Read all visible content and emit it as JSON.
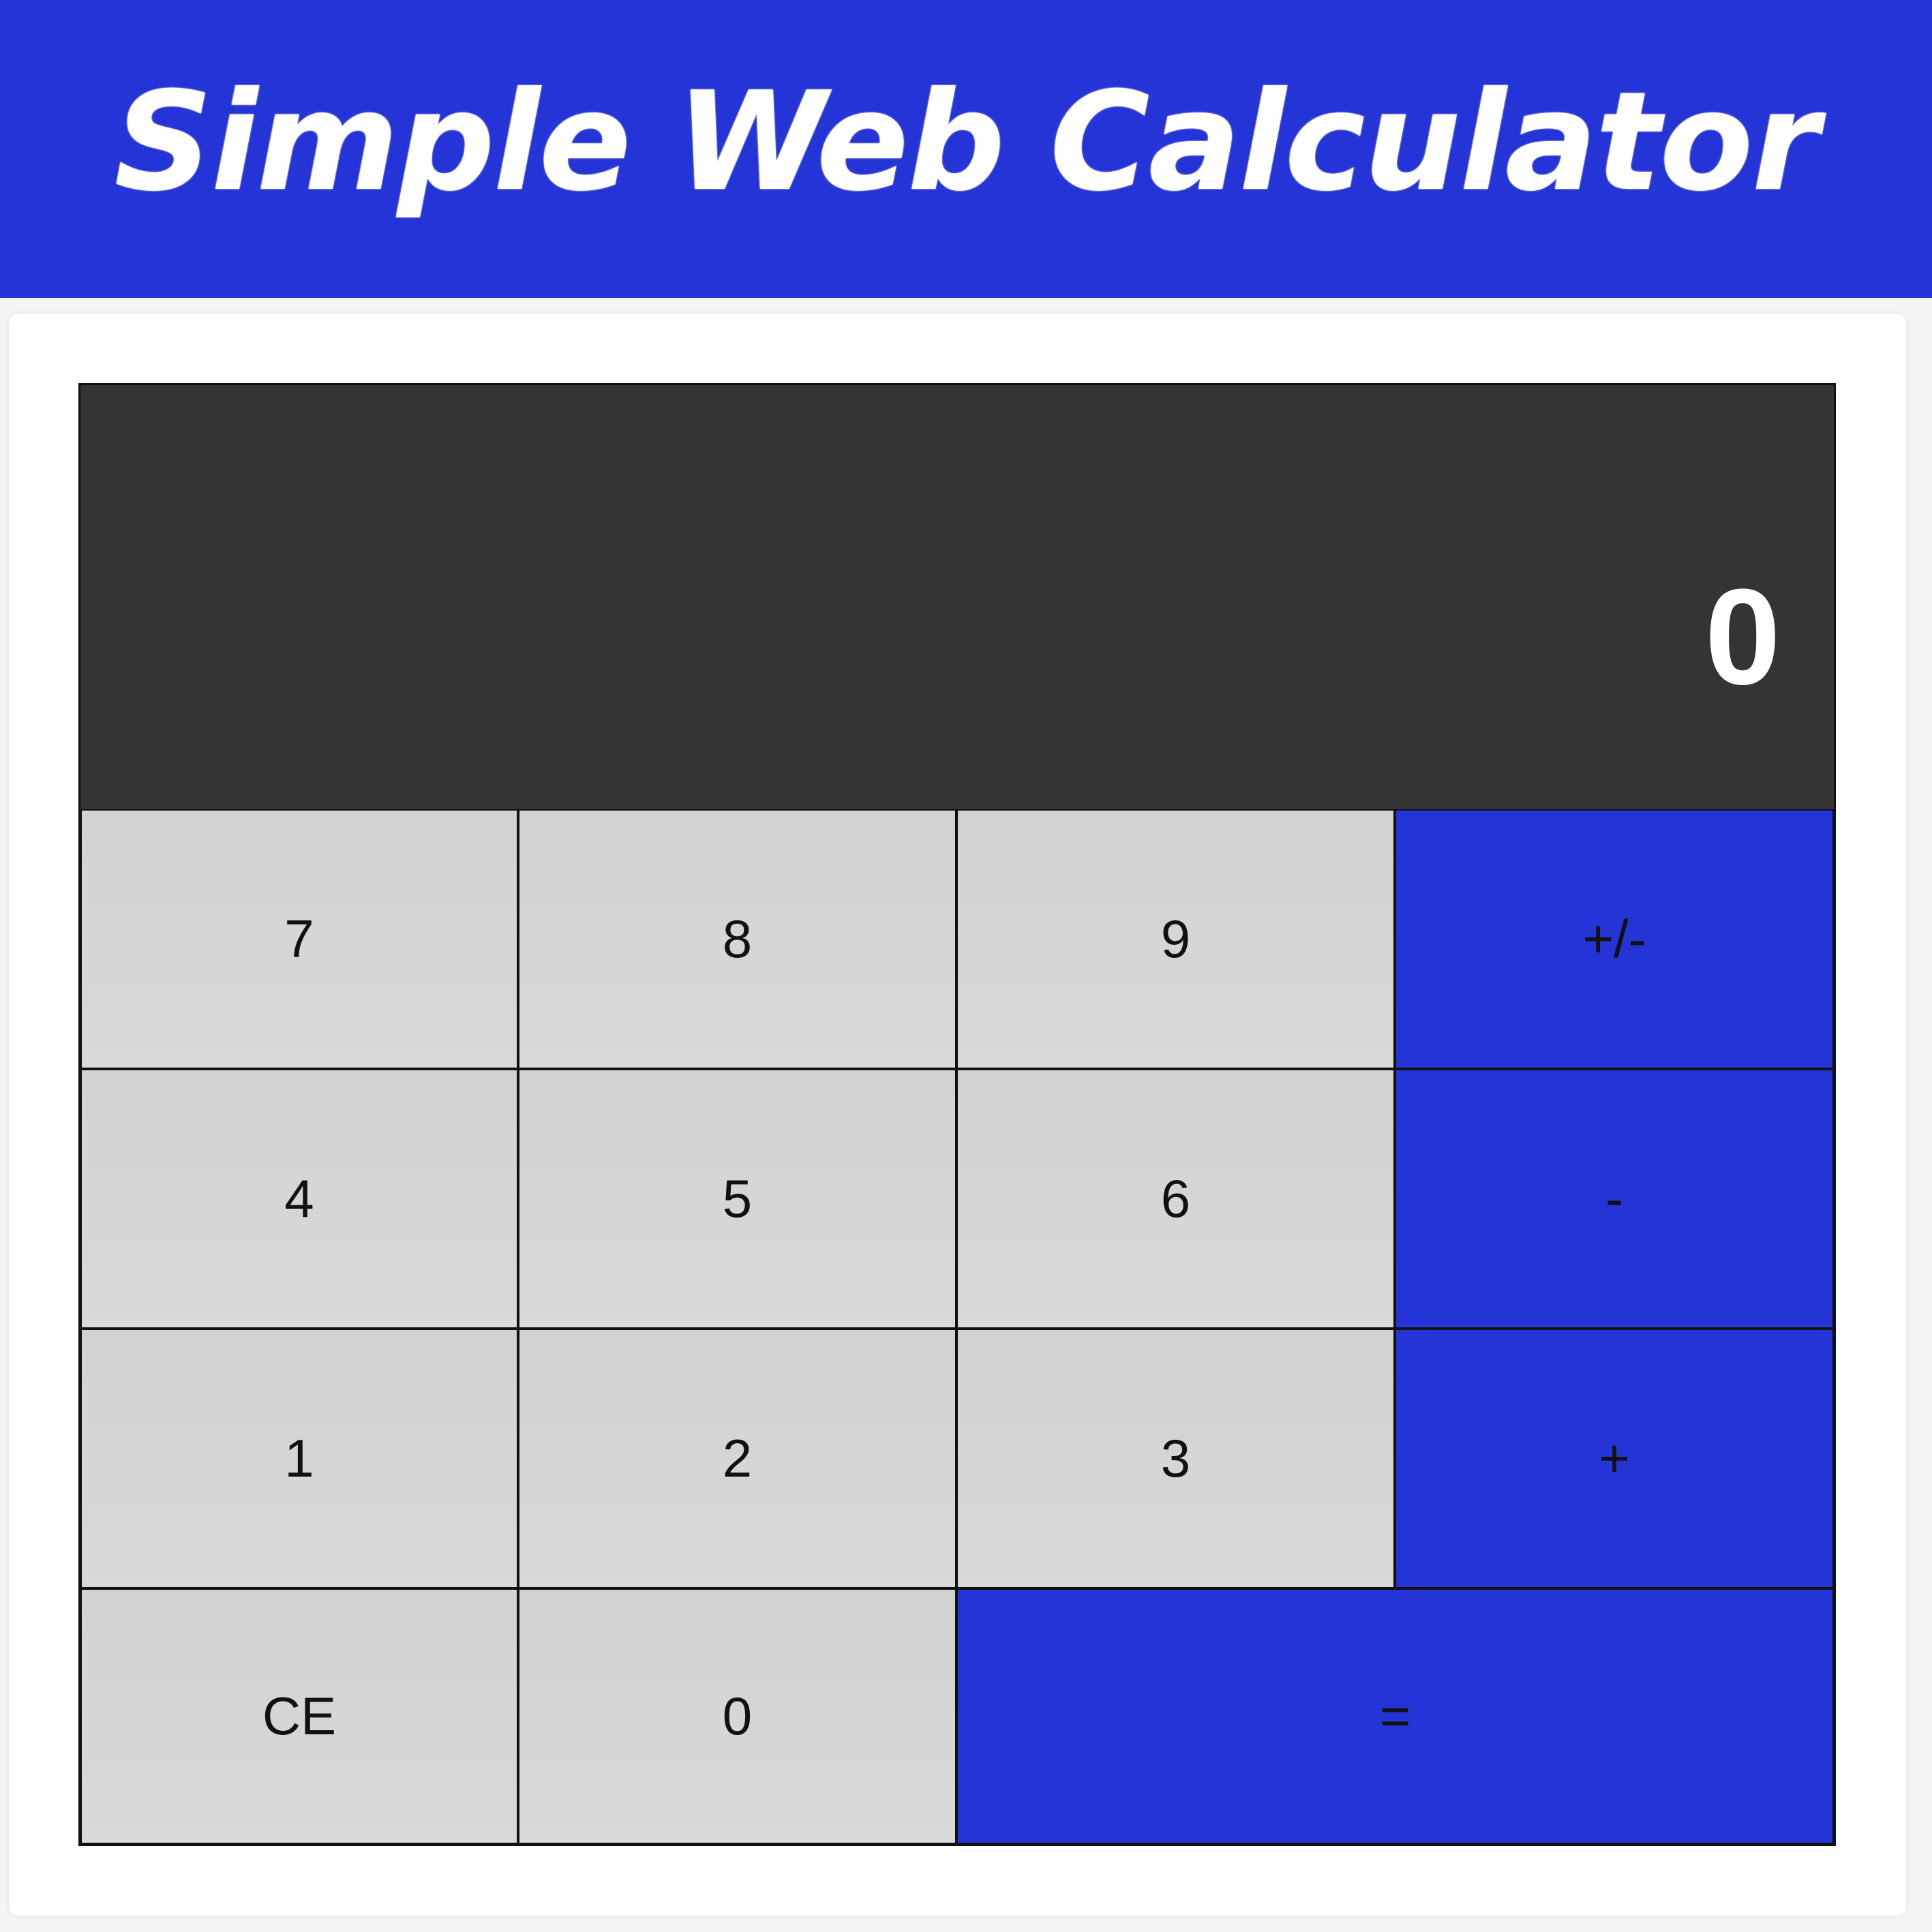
{
  "banner": {
    "title": "Simple Web Calculator"
  },
  "calculator": {
    "display": "0",
    "keys": {
      "k7": "7",
      "k8": "8",
      "k9": "9",
      "plus_minus": "+/-",
      "k4": "4",
      "k5": "5",
      "k6": "6",
      "minus": "-",
      "k1": "1",
      "k2": "2",
      "k3": "3",
      "plus": "+",
      "clear": "CE",
      "k0": "0",
      "equals": "="
    }
  },
  "colors": {
    "accent": "#2534d7",
    "display_bg": "#343434",
    "key_bg": "#d4d4d4"
  }
}
